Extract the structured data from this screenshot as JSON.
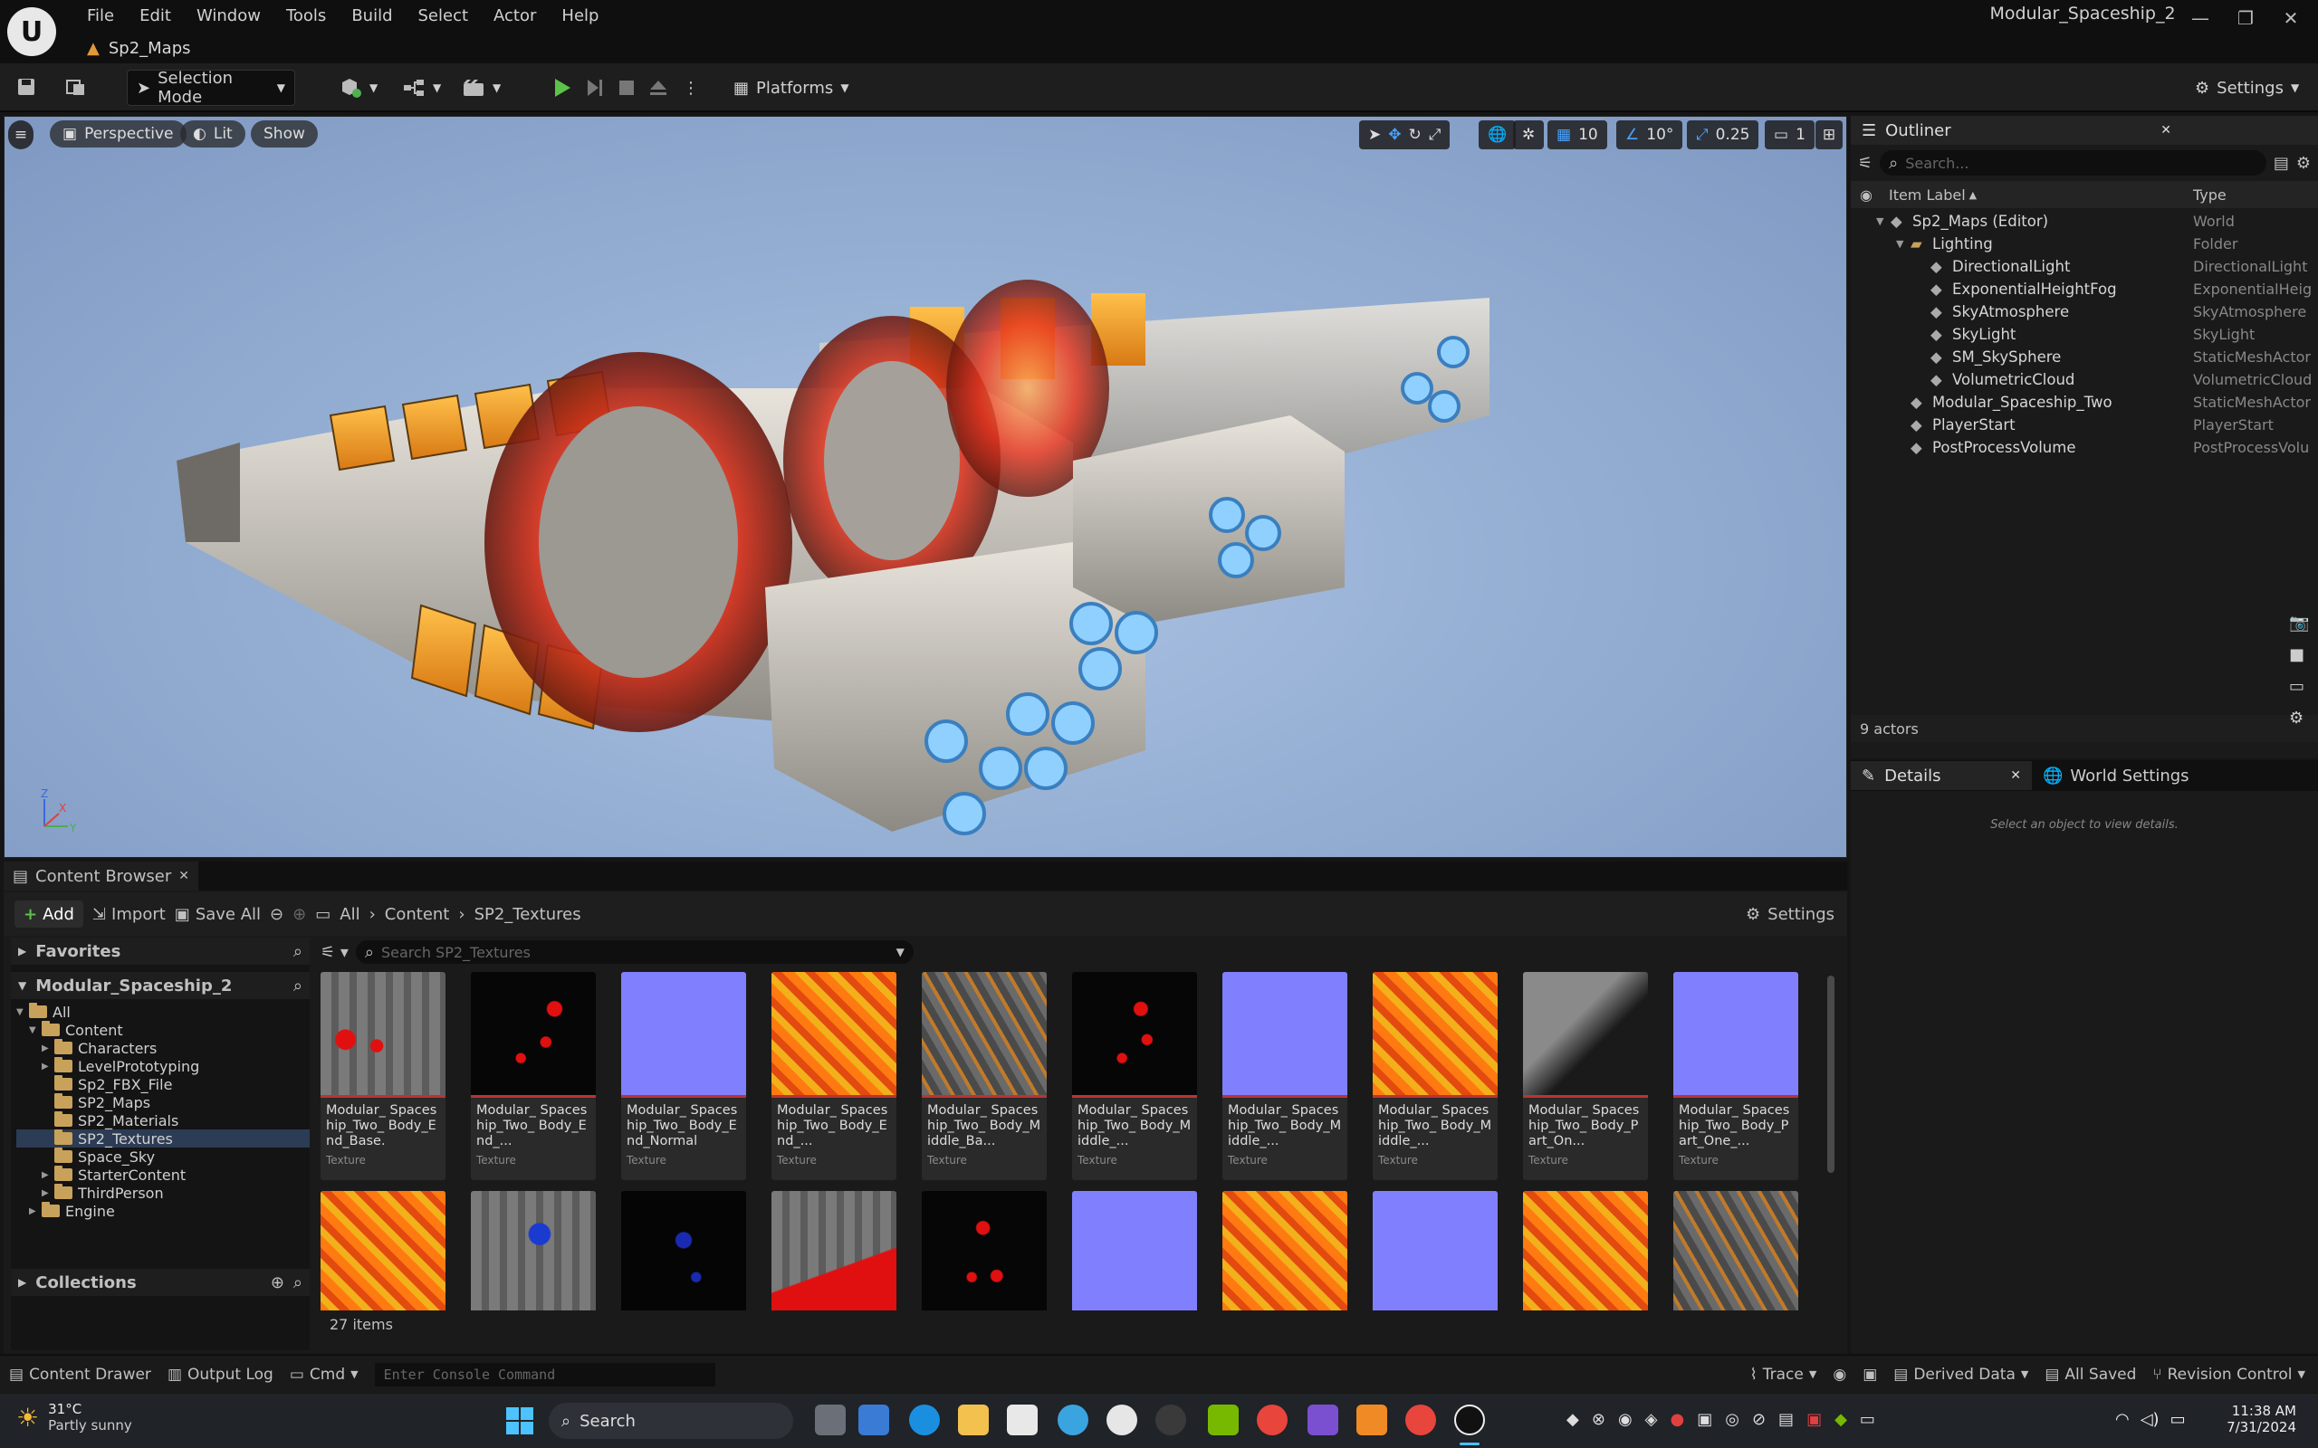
{
  "app": {
    "title": "Modular_Spaceship_2",
    "map_tab": "Sp2_Maps"
  },
  "menu": [
    "File",
    "Edit",
    "Window",
    "Tools",
    "Build",
    "Select",
    "Actor",
    "Help"
  ],
  "toolbar": {
    "mode": "Selection Mode",
    "platforms": "Platforms",
    "settings": "Settings"
  },
  "viewport": {
    "perspective": "Perspective",
    "lit": "Lit",
    "show": "Show",
    "grid_snap": "10",
    "rot_snap": "10°",
    "scale_snap": "0.25",
    "cam_speed": "1"
  },
  "outliner": {
    "title": "Outliner",
    "search_placeholder": "Search...",
    "col_label": "Item Label",
    "col_type": "Type",
    "rows": [
      {
        "label": "Sp2_Maps (Editor)",
        "type": "World",
        "indent": 0
      },
      {
        "label": "Lighting",
        "type": "Folder",
        "indent": 1
      },
      {
        "label": "DirectionalLight",
        "type": "DirectionalLight",
        "indent": 2
      },
      {
        "label": "ExponentialHeightFog",
        "type": "ExponentialHeig",
        "indent": 2
      },
      {
        "label": "SkyAtmosphere",
        "type": "SkyAtmosphere",
        "indent": 2
      },
      {
        "label": "SkyLight",
        "type": "SkyLight",
        "indent": 2
      },
      {
        "label": "SM_SkySphere",
        "type": "StaticMeshActor",
        "indent": 2
      },
      {
        "label": "VolumetricCloud",
        "type": "VolumetricCloud",
        "indent": 2
      },
      {
        "label": "Modular_Spaceship_Two",
        "type": "StaticMeshActor",
        "indent": 1
      },
      {
        "label": "PlayerStart",
        "type": "PlayerStart",
        "indent": 1
      },
      {
        "label": "PostProcessVolume",
        "type": "PostProcessVolu",
        "indent": 1
      }
    ],
    "count": "9 actors"
  },
  "details": {
    "tab": "Details",
    "world_tab": "World Settings",
    "empty": "Select an object to view details."
  },
  "content_browser": {
    "tab": "Content Browser",
    "add": "Add",
    "import": "Import",
    "save_all": "Save All",
    "path": [
      "All",
      "Content",
      "SP2_Textures"
    ],
    "settings": "Settings",
    "search_placeholder": "Search SP2_Textures",
    "favorites": "Favorites",
    "project": "Modular_Spaceship_2",
    "collections": "Collections",
    "tree": [
      {
        "label": "All",
        "indent": 0
      },
      {
        "label": "Content",
        "indent": 1
      },
      {
        "label": "Characters",
        "indent": 2
      },
      {
        "label": "LevelPrototyping",
        "indent": 2
      },
      {
        "label": "Sp2_FBX_File",
        "indent": 2
      },
      {
        "label": "SP2_Maps",
        "indent": 2
      },
      {
        "label": "SP2_Materials",
        "indent": 2
      },
      {
        "label": "SP2_Textures",
        "indent": 2
      },
      {
        "label": "Space_Sky",
        "indent": 2
      },
      {
        "label": "StarterContent",
        "indent": 2
      },
      {
        "label": "ThirdPerson",
        "indent": 2
      },
      {
        "label": "Engine",
        "indent": 1
      }
    ],
    "item_count": "27 items",
    "assets": [
      {
        "label": "Modular_ Spaceship_Two_ Body_End_Base.",
        "type": "Texture",
        "kind": "mask-gray"
      },
      {
        "label": "Modular_ Spaceship_Two_ Body_End_...",
        "type": "Texture",
        "kind": "red-dark"
      },
      {
        "label": "Modular_ Spaceship_Two_ Body_End_Normal",
        "type": "Texture",
        "kind": "normal"
      },
      {
        "label": "Modular_ Spaceship_Two_ Body_End_...",
        "type": "Texture",
        "kind": "orange"
      },
      {
        "label": "Modular_ Spaceship_Two_ Body_Middle_Ba...",
        "type": "Texture",
        "kind": "gray-orange"
      },
      {
        "label": "Modular_ Spaceship_Two_ Body_Middle_...",
        "type": "Texture",
        "kind": "red-dark"
      },
      {
        "label": "Modular_ Spaceship_Two_ Body_Middle_...",
        "type": "Texture",
        "kind": "normal"
      },
      {
        "label": "Modular_ Spaceship_Two_ Body_Middle_...",
        "type": "Texture",
        "kind": "orange"
      },
      {
        "label": "Modular_ Spaceship_Two_ Body_Part_On...",
        "type": "Texture",
        "kind": "gray-dark"
      },
      {
        "label": "Modular_ Spaceship_Two_ Body_Part_One_...",
        "type": "Texture",
        "kind": "normal"
      }
    ],
    "row2": [
      "orange",
      "gray-blue",
      "blue-dark",
      "gray-red",
      "red-dark",
      "normal",
      "orange",
      "normal",
      "orange",
      "gray-orange"
    ]
  },
  "statusbar": {
    "content_drawer": "Content Drawer",
    "output_log": "Output Log",
    "cmd": "Cmd",
    "console_placeholder": "Enter Console Command",
    "trace": "Trace",
    "derived_data": "Derived Data",
    "all_saved": "All Saved",
    "revision_control": "Revision Control"
  },
  "taskbar": {
    "temp": "31°C",
    "weather": "Partly sunny",
    "search": "Search",
    "time": "11:38 AM",
    "date": "7/31/2024"
  }
}
